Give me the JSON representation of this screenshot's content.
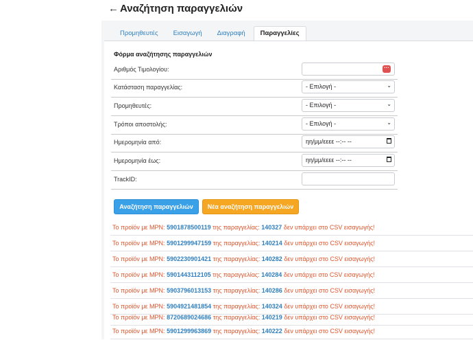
{
  "header": {
    "back_icon": "arrow-left-icon",
    "title": "Αναζήτηση παραγγελιών"
  },
  "tabs": [
    {
      "label": "Προμηθευτές",
      "active": false
    },
    {
      "label": "Εισαγωγή",
      "active": false
    },
    {
      "label": "Διαγραφή",
      "active": false
    },
    {
      "label": "Παραγγελίες",
      "active": true
    }
  ],
  "form": {
    "title": "Φόρμα αναζήτησης παραγγελιών",
    "fields": [
      {
        "label": "Αριθμός Τιμολογίου:",
        "value": ""
      },
      {
        "label": "Κατάσταση παραγγελίας:",
        "value": "- Επιλογή -"
      },
      {
        "label": "Προμηθευτές:",
        "value": "- Επιλογή -"
      },
      {
        "label": "Τρόποι αποστολής:",
        "value": "- Επιλογή -"
      },
      {
        "label": "Ημερομηνία από:",
        "value": "ηη/μμ/εεεε --:-- --"
      },
      {
        "label": "Ημερομηνία έως:",
        "value": "ηη/μμ/εεεε --:-- --"
      },
      {
        "label": "TrackID:",
        "value": ""
      }
    ],
    "search_button": "Αναζήτηση παραγγελιών",
    "new_search_button": "Νέα αναζήτηση παραγγελιών"
  },
  "messages": {
    "prefix": "Το προϊόν με MPN:",
    "middle": "της παραγγελίας:",
    "suffix": "δεν υπάρχει στο CSV εισαγωγής!",
    "rows": [
      {
        "mpn": "5901878500119",
        "order": "140327"
      },
      {
        "mpn": "5901299947159",
        "order": "140214"
      },
      {
        "mpn": "5902230901421",
        "order": "140282"
      },
      {
        "mpn": "5901443112105",
        "order": "140284"
      },
      {
        "mpn": "5903796013153",
        "order": "140286"
      },
      {
        "mpn": "5904921481854",
        "order": "140324"
      },
      {
        "mpn": "8720689024686",
        "order": "140219"
      },
      {
        "mpn": "5901299963869",
        "order": "140222"
      }
    ]
  },
  "colors": {
    "accent_blue": "#3aa0e8",
    "accent_orange": "#f5a623",
    "warning_text": "#e0532a",
    "link_blue": "#2f7fbf"
  }
}
